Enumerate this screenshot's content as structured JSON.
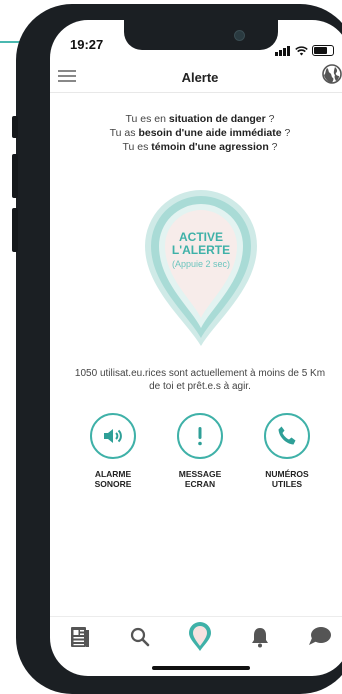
{
  "status_bar": {
    "time": "19:27"
  },
  "header": {
    "title": "Alerte",
    "menu_icon": "hamburger-icon",
    "globe_icon": "globe-icon"
  },
  "intro": {
    "line1_prefix": "Tu es en ",
    "line1_bold": "situation de danger",
    "line1_suffix": " ?",
    "line2_prefix": "Tu as ",
    "line2_bold": "besoin d'une aide immédiate",
    "line2_suffix": " ?",
    "line3_prefix": "Tu es ",
    "line3_bold": "témoin d'une agression",
    "line3_suffix": " ?"
  },
  "alert_button": {
    "line1": "ACTIVE",
    "line2": "L'ALERTE",
    "hint": "(Appuie 2 sec)"
  },
  "stats_text": "1050 utilisat.eu.rices sont actuellement à moins de 5 Km de toi et prêt.e.s à agir.",
  "actions": [
    {
      "line1": "ALARME",
      "line2": "SONORE",
      "icon": "speaker-icon"
    },
    {
      "line1": "MESSAGE",
      "line2": "ECRAN",
      "icon": "exclamation-icon"
    },
    {
      "line1": "NUMÉROS",
      "line2": "UTILES",
      "icon": "phone-icon"
    }
  ],
  "tabbar": [
    "news-icon",
    "search-icon",
    "alert-pin-icon",
    "bell-icon",
    "chat-icon"
  ],
  "colors": {
    "accent": "#3fb1a8",
    "pin_inner": "#f7ecea",
    "frame": "#1b1f23"
  }
}
